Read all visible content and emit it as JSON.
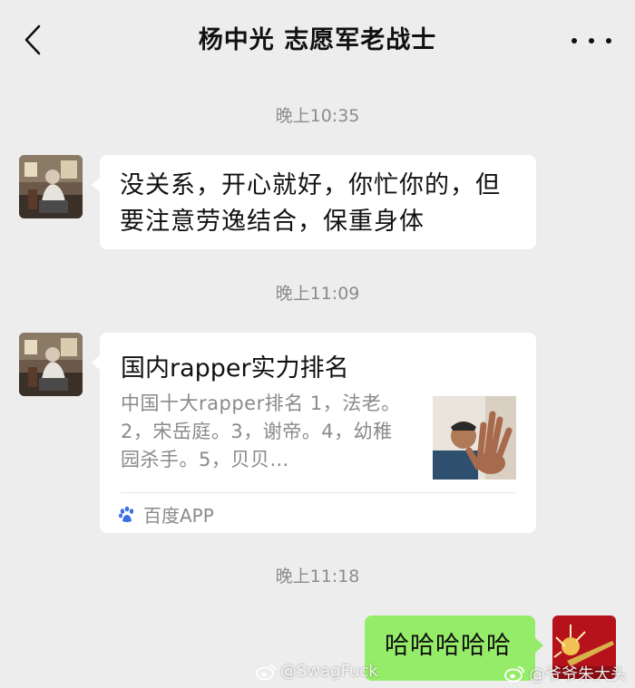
{
  "header": {
    "title": "杨中光 志愿军老战士",
    "back_icon": "chevron-left-icon",
    "more_icon": "more-dots-icon"
  },
  "messages": [
    {
      "time": "晚上10:35",
      "text": "没关系，开心就好，你忙你的，但要注意劳逸结合，保重身体"
    },
    {
      "time": "晚上11:09",
      "card": {
        "title": "国内rapper实力排名",
        "desc": "中国十大rapper排名 1，法老。2，宋岳庭。3，谢帝。4，幼稚园杀手。5，贝贝…",
        "source": "百度APP",
        "source_icon": "baidu-paw-icon"
      }
    },
    {
      "time": "晚上11:18",
      "text": "哈哈哈哈哈"
    }
  ],
  "watermarks": [
    "@SwagFuck",
    "@爷爷朱大头"
  ],
  "colors": {
    "background": "#ededed",
    "bubble_in": "#ffffff",
    "bubble_out": "#95ec69",
    "baidu_blue": "#3b6de3"
  }
}
